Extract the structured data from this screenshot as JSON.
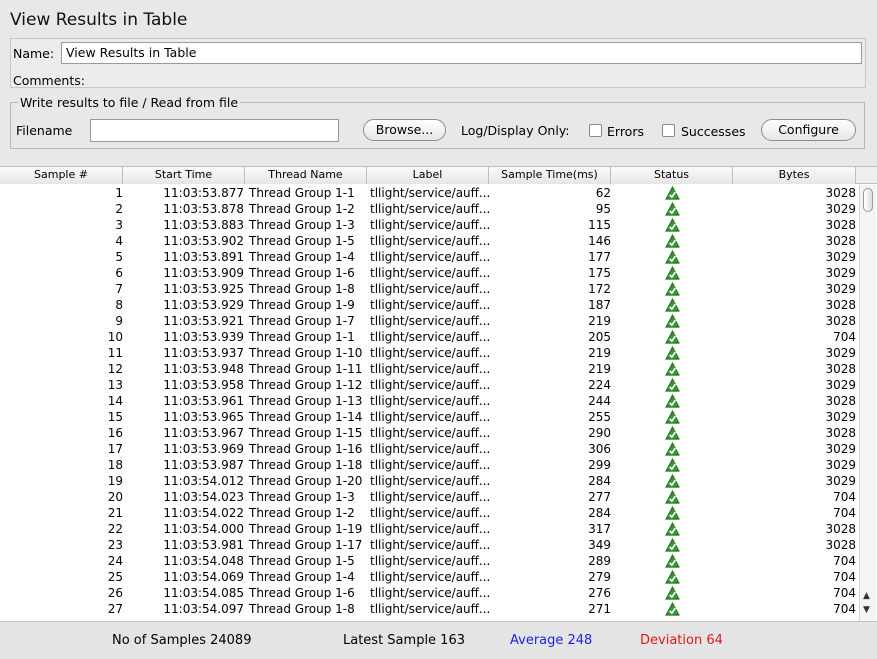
{
  "title": "View Results in Table",
  "name_label": "Name:",
  "name_value": "View Results in Table",
  "comments_label": "Comments:",
  "file_legend": "Write results to file / Read from file",
  "filename_label": "Filename",
  "filename_value": "",
  "browse_label": "Browse...",
  "logdisplay_label": "Log/Display Only:",
  "errors_label": "Errors",
  "errors_checked": false,
  "successes_label": "Successes",
  "successes_checked": false,
  "configure_label": "Configure",
  "columns": [
    "Sample #",
    "Start Time",
    "Thread Name",
    "Label",
    "Sample Time(ms)",
    "Status",
    "Bytes"
  ],
  "rows": [
    {
      "sample": "1",
      "start": "11:03:53.877",
      "thread": "Thread Group 1-1",
      "label": "tllight/service/auff...",
      "ms": "62",
      "status": "success-icon",
      "bytes": "3028"
    },
    {
      "sample": "2",
      "start": "11:03:53.878",
      "thread": "Thread Group 1-2",
      "label": "tllight/service/auff...",
      "ms": "95",
      "status": "success-icon",
      "bytes": "3029"
    },
    {
      "sample": "3",
      "start": "11:03:53.883",
      "thread": "Thread Group 1-3",
      "label": "tllight/service/auff...",
      "ms": "115",
      "status": "success-icon",
      "bytes": "3028"
    },
    {
      "sample": "4",
      "start": "11:03:53.902",
      "thread": "Thread Group 1-5",
      "label": "tllight/service/auff...",
      "ms": "146",
      "status": "success-icon",
      "bytes": "3028"
    },
    {
      "sample": "5",
      "start": "11:03:53.891",
      "thread": "Thread Group 1-4",
      "label": "tllight/service/auff...",
      "ms": "177",
      "status": "success-icon",
      "bytes": "3029"
    },
    {
      "sample": "6",
      "start": "11:03:53.909",
      "thread": "Thread Group 1-6",
      "label": "tllight/service/auff...",
      "ms": "175",
      "status": "success-icon",
      "bytes": "3029"
    },
    {
      "sample": "7",
      "start": "11:03:53.925",
      "thread": "Thread Group 1-8",
      "label": "tllight/service/auff...",
      "ms": "172",
      "status": "success-icon",
      "bytes": "3029"
    },
    {
      "sample": "8",
      "start": "11:03:53.929",
      "thread": "Thread Group 1-9",
      "label": "tllight/service/auff...",
      "ms": "187",
      "status": "success-icon",
      "bytes": "3028"
    },
    {
      "sample": "9",
      "start": "11:03:53.921",
      "thread": "Thread Group 1-7",
      "label": "tllight/service/auff...",
      "ms": "219",
      "status": "success-icon",
      "bytes": "3028"
    },
    {
      "sample": "10",
      "start": "11:03:53.939",
      "thread": "Thread Group 1-1",
      "label": "tllight/service/auff...",
      "ms": "205",
      "status": "success-icon",
      "bytes": "704"
    },
    {
      "sample": "11",
      "start": "11:03:53.937",
      "thread": "Thread Group 1-10",
      "label": "tllight/service/auff...",
      "ms": "219",
      "status": "success-icon",
      "bytes": "3029"
    },
    {
      "sample": "12",
      "start": "11:03:53.948",
      "thread": "Thread Group 1-11",
      "label": "tllight/service/auff...",
      "ms": "219",
      "status": "success-icon",
      "bytes": "3028"
    },
    {
      "sample": "13",
      "start": "11:03:53.958",
      "thread": "Thread Group 1-12",
      "label": "tllight/service/auff...",
      "ms": "224",
      "status": "success-icon",
      "bytes": "3029"
    },
    {
      "sample": "14",
      "start": "11:03:53.961",
      "thread": "Thread Group 1-13",
      "label": "tllight/service/auff...",
      "ms": "244",
      "status": "success-icon",
      "bytes": "3028"
    },
    {
      "sample": "15",
      "start": "11:03:53.965",
      "thread": "Thread Group 1-14",
      "label": "tllight/service/auff...",
      "ms": "255",
      "status": "success-icon",
      "bytes": "3029"
    },
    {
      "sample": "16",
      "start": "11:03:53.967",
      "thread": "Thread Group 1-15",
      "label": "tllight/service/auff...",
      "ms": "290",
      "status": "success-icon",
      "bytes": "3028"
    },
    {
      "sample": "17",
      "start": "11:03:53.969",
      "thread": "Thread Group 1-16",
      "label": "tllight/service/auff...",
      "ms": "306",
      "status": "success-icon",
      "bytes": "3029"
    },
    {
      "sample": "18",
      "start": "11:03:53.987",
      "thread": "Thread Group 1-18",
      "label": "tllight/service/auff...",
      "ms": "299",
      "status": "success-icon",
      "bytes": "3029"
    },
    {
      "sample": "19",
      "start": "11:03:54.012",
      "thread": "Thread Group 1-20",
      "label": "tllight/service/auff...",
      "ms": "284",
      "status": "success-icon",
      "bytes": "3029"
    },
    {
      "sample": "20",
      "start": "11:03:54.023",
      "thread": "Thread Group 1-3",
      "label": "tllight/service/auff...",
      "ms": "277",
      "status": "success-icon",
      "bytes": "704"
    },
    {
      "sample": "21",
      "start": "11:03:54.022",
      "thread": "Thread Group 1-2",
      "label": "tllight/service/auff...",
      "ms": "284",
      "status": "success-icon",
      "bytes": "704"
    },
    {
      "sample": "22",
      "start": "11:03:54.000",
      "thread": "Thread Group 1-19",
      "label": "tllight/service/auff...",
      "ms": "317",
      "status": "success-icon",
      "bytes": "3028"
    },
    {
      "sample": "23",
      "start": "11:03:53.981",
      "thread": "Thread Group 1-17",
      "label": "tllight/service/auff...",
      "ms": "349",
      "status": "success-icon",
      "bytes": "3028"
    },
    {
      "sample": "24",
      "start": "11:03:54.048",
      "thread": "Thread Group 1-5",
      "label": "tllight/service/auff...",
      "ms": "289",
      "status": "success-icon",
      "bytes": "704"
    },
    {
      "sample": "25",
      "start": "11:03:54.069",
      "thread": "Thread Group 1-4",
      "label": "tllight/service/auff...",
      "ms": "279",
      "status": "success-icon",
      "bytes": "704"
    },
    {
      "sample": "26",
      "start": "11:03:54.085",
      "thread": "Thread Group 1-6",
      "label": "tllight/service/auff...",
      "ms": "276",
      "status": "success-icon",
      "bytes": "704"
    },
    {
      "sample": "27",
      "start": "11:03:54.097",
      "thread": "Thread Group 1-8",
      "label": "tllight/service/auff...",
      "ms": "271",
      "status": "success-icon",
      "bytes": "704"
    }
  ],
  "footer": {
    "samples": "No of Samples 24089",
    "latest": "Latest Sample 163",
    "average": "Average 248",
    "deviation": "Deviation 64"
  },
  "colors": {
    "average": "#1f1fe0",
    "deviation": "#e01818",
    "status_success": "#2e9b2e"
  }
}
